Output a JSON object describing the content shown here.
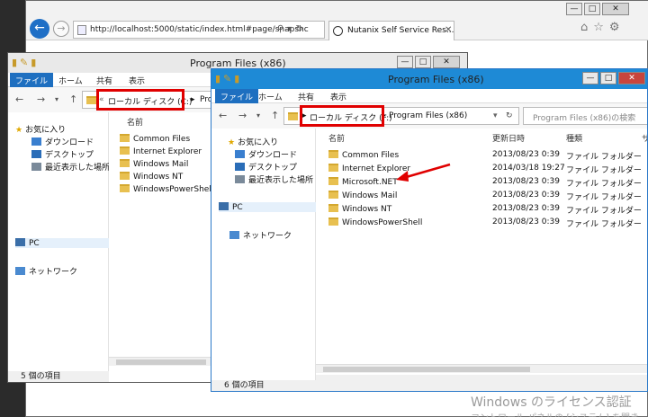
{
  "browser": {
    "url": "http://localhost:5000/static/index.html#page/snapshc",
    "tab_title": "Nutanix Self Service Res...",
    "controls": {
      "minimize": "—",
      "maximize": "□",
      "close": "✕"
    }
  },
  "explorer_back": {
    "title": "Program Files (x86)",
    "ribbon": {
      "file": "ファイル",
      "home": "ホーム",
      "share": "共有",
      "view": "表示"
    },
    "breadcrumb": {
      "drive": "ローカル ディスク (C:)",
      "folder": "Progra"
    },
    "nav": {
      "favorites": "お気に入り",
      "downloads": "ダウンロード",
      "desktop": "デスクトップ",
      "recent": "最近表示した場所",
      "pc": "PC",
      "network": "ネットワーク"
    },
    "column_name": "名前",
    "files": [
      "Common Files",
      "Internet Explorer",
      "Windows Mail",
      "Windows NT",
      "WindowsPowerShell"
    ],
    "status": "5 個の項目"
  },
  "explorer_front": {
    "title": "Program Files (x86)",
    "ribbon": {
      "file": "ファイル",
      "home": "ホーム",
      "share": "共有",
      "view": "表示"
    },
    "breadcrumb": {
      "drive": "ローカル ディスク (F:)",
      "folder": "Program Files (x86)"
    },
    "search_placeholder": "Program Files (x86)の検索",
    "nav": {
      "favorites": "お気に入り",
      "downloads": "ダウンロード",
      "desktop": "デスクトップ",
      "recent": "最近表示した場所",
      "pc": "PC",
      "network": "ネットワーク"
    },
    "columns": {
      "name": "名前",
      "modified": "更新日時",
      "type": "種類",
      "size": "サ"
    },
    "files": [
      {
        "name": "Common Files",
        "date": "2013/08/23 0:39",
        "type": "ファイル フォルダー"
      },
      {
        "name": "Internet Explorer",
        "date": "2014/03/18 19:27",
        "type": "ファイル フォルダー"
      },
      {
        "name": "Microsoft.NET",
        "date": "2013/08/23 0:39",
        "type": "ファイル フォルダー"
      },
      {
        "name": "Windows Mail",
        "date": "2013/08/23 0:39",
        "type": "ファイル フォルダー"
      },
      {
        "name": "Windows NT",
        "date": "2013/08/23 0:39",
        "type": "ファイル フォルダー"
      },
      {
        "name": "WindowsPowerShell",
        "date": "2013/08/23 0:39",
        "type": "ファイル フォルダー"
      }
    ],
    "status": "6 個の項目"
  },
  "watermark": {
    "line1": "Windows のライセンス認証",
    "line2": "コントロール パネルの [システム] を開き"
  }
}
